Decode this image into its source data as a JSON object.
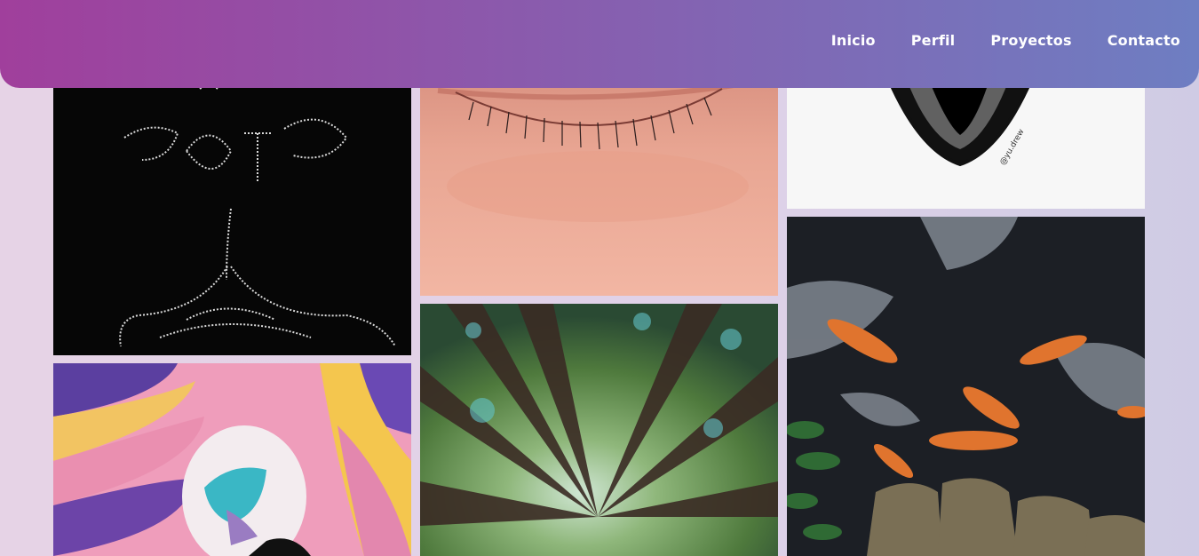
{
  "header": {
    "gradient_start": "#a03f9c",
    "gradient_end": "#6e7ec2"
  },
  "nav": {
    "items": [
      {
        "label": "Inicio"
      },
      {
        "label": "Perfil"
      },
      {
        "label": "Proyectos"
      },
      {
        "label": "Contacto"
      }
    ]
  },
  "gallery": {
    "items": [
      {
        "name": "lettering-artwork",
        "caption": ""
      },
      {
        "name": "closed-eye-photo",
        "caption": ""
      },
      {
        "name": "heart-illustration",
        "caption": "@yu.drew"
      },
      {
        "name": "colorful-mural",
        "caption": ""
      },
      {
        "name": "forest-canopy-photo",
        "caption": ""
      },
      {
        "name": "koi-pond-photo",
        "caption": ""
      }
    ]
  }
}
